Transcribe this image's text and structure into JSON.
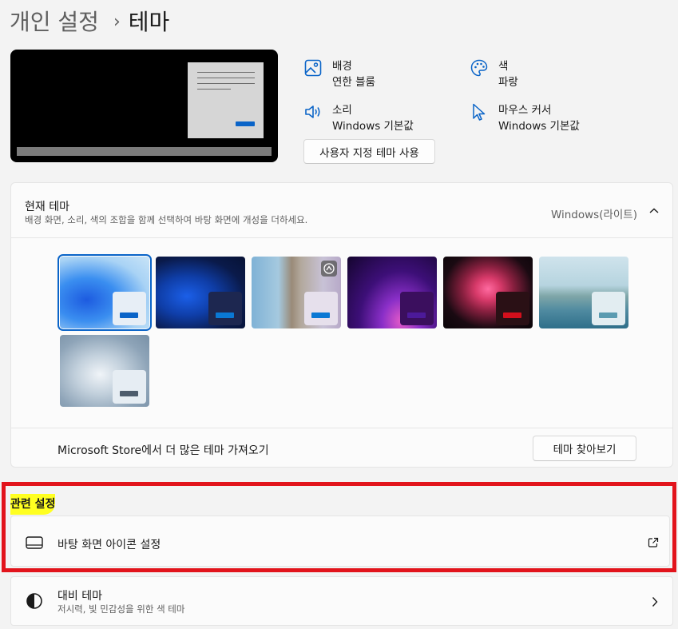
{
  "breadcrumb": {
    "parent": "개인 설정",
    "separator": "›",
    "current": "테마"
  },
  "properties": {
    "background": {
      "label": "배경",
      "value": "연한 블룸",
      "icon": "image-icon"
    },
    "color": {
      "label": "색",
      "value": "파랑",
      "icon": "palette-icon"
    },
    "sound": {
      "label": "소리",
      "value": "Windows 기본값",
      "icon": "speaker-icon"
    },
    "cursor": {
      "label": "마우스 커서",
      "value": "Windows 기본값",
      "icon": "cursor-icon"
    }
  },
  "custom_theme_button": "사용자 지정 테마 사용",
  "current_theme": {
    "title": "현재 테마",
    "subtitle": "배경 화면, 소리, 색의 조합을 함께 선택하여 바탕 화면에 개성을 더하세요.",
    "value": "Windows(라이트)",
    "themes": [
      {
        "name": "windows-light",
        "selected": true,
        "accent": "#0a64c8"
      },
      {
        "name": "windows-dark",
        "selected": false,
        "accent": "#0a64c8"
      },
      {
        "name": "spotlight",
        "selected": false,
        "accent": "#0a78d4"
      },
      {
        "name": "glow",
        "selected": false,
        "accent": "#4c1a9a"
      },
      {
        "name": "captured-motion",
        "selected": false,
        "accent": "#d20f1c"
      },
      {
        "name": "sunrise-lake",
        "selected": false,
        "accent": "#5a9bb0"
      },
      {
        "name": "flow",
        "selected": false,
        "accent": "#4d5c6c"
      }
    ],
    "store_text": "Microsoft Store에서 더 많은 테마 가져오기",
    "browse_button": "테마 찾아보기"
  },
  "related": {
    "heading": "관련 설정",
    "desktop_icons": {
      "label": "바탕 화면 아이콘 설정",
      "icon": "monitor-icon",
      "trailing_icon": "external-link-icon"
    },
    "contrast": {
      "label": "대비 테마",
      "subtitle": "저시력, 빛 민감성을 위한 색 테마",
      "icon": "contrast-icon",
      "trailing_icon": "chevron-right-icon"
    }
  },
  "colors": {
    "accent": "#0a64c8",
    "highlight_border": "#e2141c",
    "highlight_marker": "#ffff21"
  }
}
